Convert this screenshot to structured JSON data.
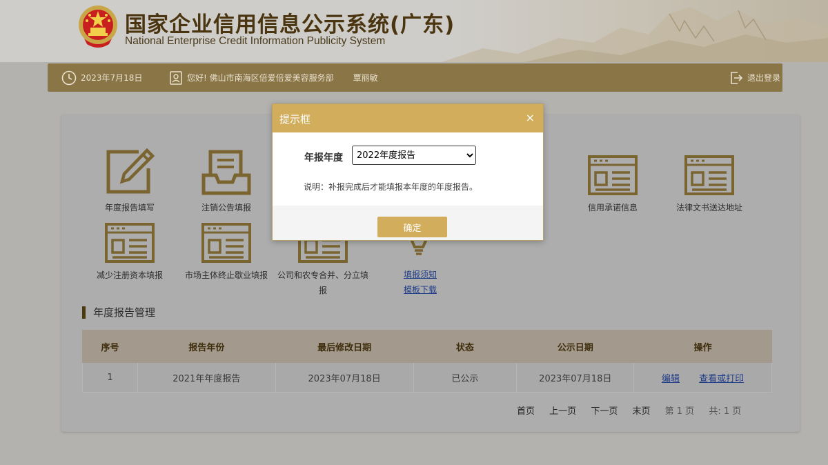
{
  "header": {
    "title": "国家企业信用信息公示系统(广东)",
    "subtitle": "National Enterprise Credit Information Publicity System"
  },
  "topbar": {
    "date": "2023年7月18日",
    "greeting": "您好! 佛山市南海区倍爱倍爱美容服务部",
    "user": "覃丽敏",
    "logout": "退出登录"
  },
  "tiles": [
    {
      "label": "年度报告填写",
      "icon": "pencil-doc-icon"
    },
    {
      "label": "注销公告填报",
      "icon": "tray-doc-icon"
    },
    {
      "label": "信用承诺信息",
      "icon": "form-doc-icon"
    },
    {
      "label": "法律文书送达地址",
      "icon": "form-doc-icon"
    },
    {
      "label": "减少注册资本填报",
      "icon": "form-doc-icon"
    },
    {
      "label": "市场主体终止歇业填报",
      "icon": "form-doc-icon"
    },
    {
      "label": "公司和农专合并、分立填报",
      "icon": "form-doc-icon"
    }
  ],
  "links": {
    "guide": "填报须知",
    "template": "模板下载"
  },
  "section": {
    "title": "年度报告管理"
  },
  "table": {
    "headers": [
      "序号",
      "报告年份",
      "最后修改日期",
      "状态",
      "公示日期",
      "操作"
    ],
    "rows": [
      {
        "no": "1",
        "year": "2021年年度报告",
        "modified": "2023年07月18日",
        "status": "已公示",
        "published": "2023年07月18日",
        "edit": "编辑",
        "view": "查看或打印"
      }
    ]
  },
  "pager": {
    "first": "首页",
    "prev": "上一页",
    "next": "下一页",
    "last": "末页",
    "current": "第 1 页",
    "total": "共: 1 页"
  },
  "modal": {
    "title": "提示框",
    "close": "×",
    "field_label": "年报年度",
    "selected": "2022年度报告",
    "note": "说明：补报完成后才能填报本年度的年度报告。",
    "confirm": "确定"
  },
  "colors": {
    "accent": "#d2ad5c",
    "topbar": "#8a7546",
    "title": "#4a3510",
    "link": "#1f3c88"
  }
}
